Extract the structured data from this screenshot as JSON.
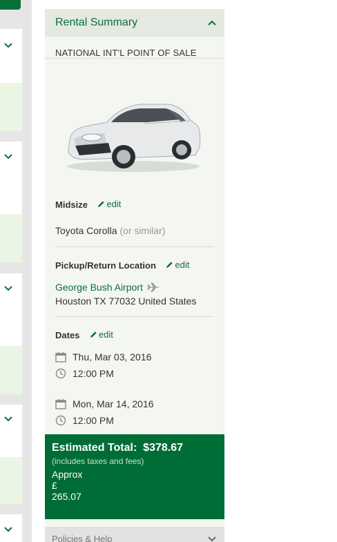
{
  "summary": {
    "title": "Rental Summary",
    "point_of_sale": "NATIONAL INT'L POINT OF SALE",
    "car": {
      "class_label": "Midsize",
      "edit_label": "edit",
      "model": "Toyota Corolla",
      "similar": "(or similar)"
    },
    "location": {
      "title": "Pickup/Return Location",
      "edit_label": "edit",
      "name": "George Bush Airport",
      "address": "Houston TX 77032 United States"
    },
    "dates": {
      "title": "Dates",
      "edit_label": "edit",
      "pickup_date": "Thu, Mar 03, 2016",
      "pickup_time": "12:00 PM",
      "return_date": "Mon, Mar 14, 2016",
      "return_time": "12:00 PM"
    },
    "total": {
      "label": "Estimated Total:",
      "amount": "$378.67",
      "note": "(includes taxes and fees)",
      "approx_label": "Approx",
      "approx_currency": "£",
      "approx_amount": "265.07"
    },
    "policies_label": "Policies & Help"
  },
  "colors": {
    "brand_green": "#0a6e3a",
    "total_bg": "#006d36",
    "panel_bg": "#f4f6f1"
  }
}
